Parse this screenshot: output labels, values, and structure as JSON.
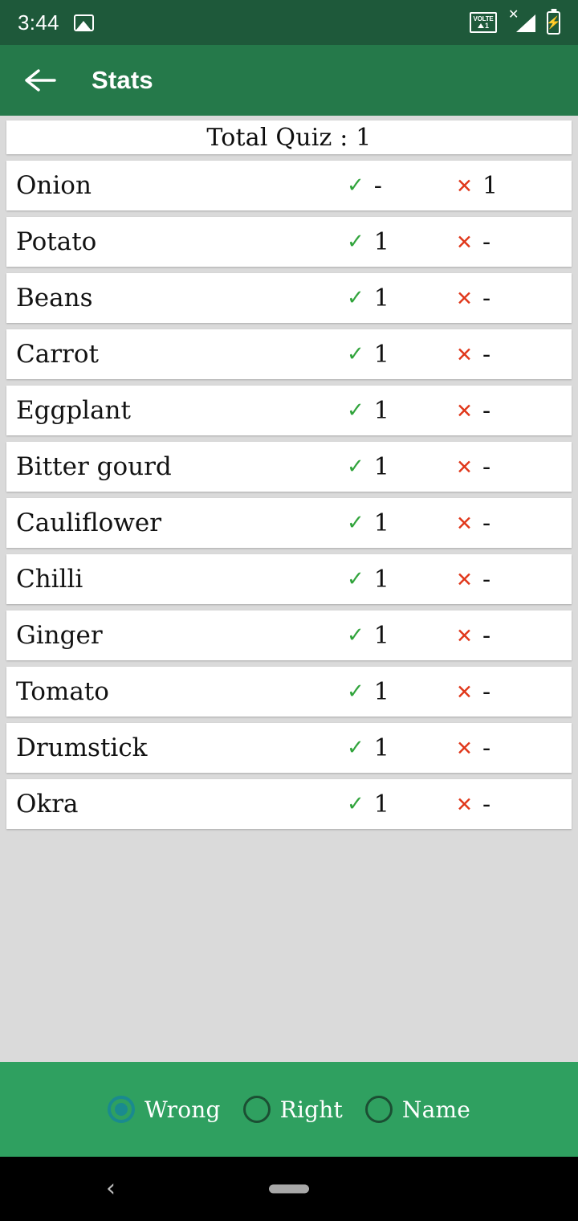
{
  "status_bar": {
    "clock": "3:44",
    "image_icon": "image-icon",
    "volte_label": "VOLTE",
    "volte_sim": "1",
    "signal_no_service": "✕",
    "battery_charging": "⚡"
  },
  "app_bar": {
    "back_icon": "back-arrow-icon",
    "title": "Stats"
  },
  "header": {
    "total_quiz": "Total Quiz : 1"
  },
  "columns": {
    "right_icon": "✓",
    "wrong_icon": "✕"
  },
  "rows": [
    {
      "name": "Onion",
      "right": "-",
      "wrong": "1"
    },
    {
      "name": "Potato",
      "right": "1",
      "wrong": "-"
    },
    {
      "name": "Beans",
      "right": "1",
      "wrong": "-"
    },
    {
      "name": "Carrot",
      "right": "1",
      "wrong": "-"
    },
    {
      "name": "Eggplant",
      "right": "1",
      "wrong": "-"
    },
    {
      "name": "Bitter gourd",
      "right": "1",
      "wrong": "-"
    },
    {
      "name": "Cauliflower",
      "right": "1",
      "wrong": "-"
    },
    {
      "name": "Chilli",
      "right": "1",
      "wrong": "-"
    },
    {
      "name": "Ginger",
      "right": "1",
      "wrong": "-"
    },
    {
      "name": "Tomato",
      "right": "1",
      "wrong": "-"
    },
    {
      "name": "Drumstick",
      "right": "1",
      "wrong": "-"
    },
    {
      "name": "Okra",
      "right": "1",
      "wrong": "-"
    }
  ],
  "sort_bar": {
    "options": [
      {
        "label": "Wrong",
        "selected": true
      },
      {
        "label": "Right",
        "selected": false
      },
      {
        "label": "Name",
        "selected": false
      }
    ]
  },
  "nav_bar": {
    "back_label": "‹",
    "home_handle": "gesture-pill"
  },
  "colors": {
    "status_bar_green": "#1e593a",
    "app_bar_green": "#25794a",
    "bottom_bar_green": "#2fa060",
    "page_background": "#dadada",
    "card_white": "#ffffff",
    "tick_green": "#31a43c",
    "cross_red": "#e0371a",
    "radio_selected_teal": "#1a8a8f",
    "radio_unselected_dark": "#1b4f33"
  }
}
